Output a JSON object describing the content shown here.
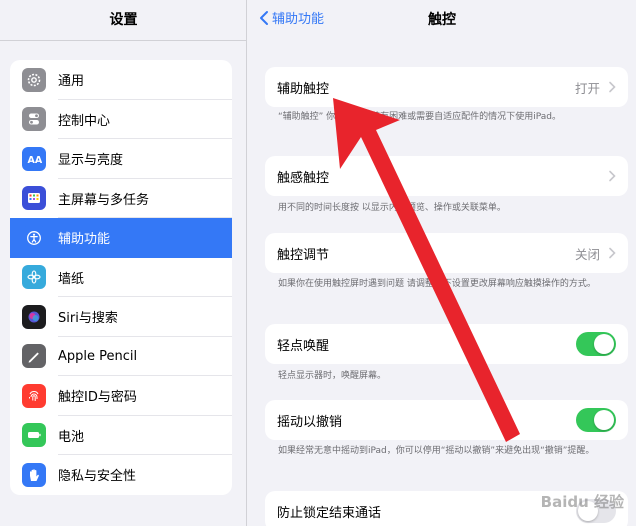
{
  "sidebar": {
    "title": "设置",
    "items": [
      {
        "label": "通用",
        "icon": "gear-icon",
        "color": "#8e8e93"
      },
      {
        "label": "控制中心",
        "icon": "toggles-icon",
        "color": "#8e8e93"
      },
      {
        "label": "显示与亮度",
        "icon": "aa-icon",
        "color": "#3478f6"
      },
      {
        "label": "主屏幕与多任务",
        "icon": "app-grid-icon",
        "color": "#3478f6"
      },
      {
        "label": "辅助功能",
        "icon": "accessibility-icon",
        "color": "#3478f6",
        "active": true
      },
      {
        "label": "墙纸",
        "icon": "flower-icon",
        "color": "#36aadc"
      },
      {
        "label": "Siri与搜索",
        "icon": "siri-icon",
        "color": "#1c1c1e"
      },
      {
        "label": "Apple Pencil",
        "icon": "pencil-icon",
        "color": "#636366"
      },
      {
        "label": "触控ID与密码",
        "icon": "fingerprint-icon",
        "color": "#ff3b30"
      },
      {
        "label": "电池",
        "icon": "battery-icon",
        "color": "#34c759"
      },
      {
        "label": "隐私与安全性",
        "icon": "hand-icon",
        "color": "#3478f6"
      }
    ]
  },
  "nav": {
    "back_label": "辅助功能",
    "title": "触控"
  },
  "settings": {
    "assistive_touch": {
      "label": "辅助触控",
      "value": "打开",
      "footnote": "“辅助触控”   你在触摸屏幕有困难或需要自适应配件的情况下使用iPad。"
    },
    "haptic_touch": {
      "label": "触感触控",
      "footnote": "用不同的时间长度按               以显示内容预览、操作或关联菜单。"
    },
    "touch_accommodations": {
      "label": "触控调节",
      "value": "关闭",
      "footnote": "如果你在使用触控屏时遇到问题       请调整以下设置更改屏幕响应触摸操作的方式。"
    },
    "tap_to_wake": {
      "label": "轻点唤醒",
      "on": true,
      "footnote": "轻点显示器时，唤醒屏幕。"
    },
    "shake_to_undo": {
      "label": "摇动以撤销",
      "on": true,
      "footnote": "如果经常无意中摇动到iPad，你可以停用“摇动以撤销”来避免出现“撤销”提醒。"
    },
    "prevent_lock_end_call": {
      "label": "防止锁定结束通话",
      "on": false
    }
  },
  "watermark": "Baidu 经验",
  "colors": {
    "accent": "#3478f6",
    "toggle_on": "#34c759",
    "arrow": "#e8242c"
  }
}
